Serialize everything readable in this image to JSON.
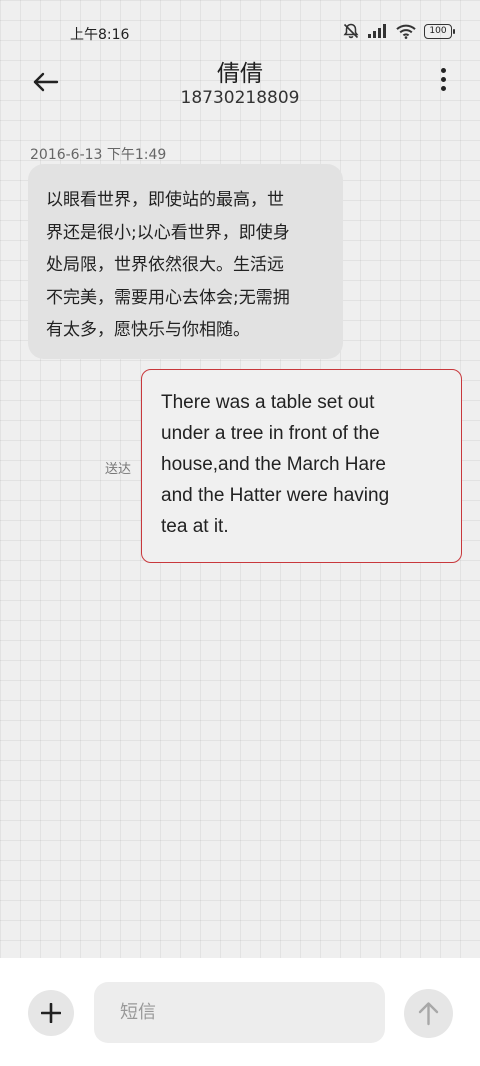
{
  "status_bar": {
    "time": "上午8:16",
    "battery": "100",
    "icons": [
      "bell-mute-icon",
      "signal-icon",
      "wifi-icon",
      "battery-icon"
    ]
  },
  "header": {
    "contact_name": "倩倩",
    "contact_number": "18730218809",
    "icons": [
      "back-arrow-icon",
      "more-vertical-icon"
    ]
  },
  "conversation": {
    "timestamp": "2016-6-13 下午1:49",
    "received": {
      "lines": [
        "以眼看世界，即使站的最高，世",
        "界还是很小;以心看世界，即使身",
        "处局限，世界依然很大。生活远",
        "不完美，需要用心去体会;无需拥",
        "有太多，愿快乐与你相随。"
      ]
    },
    "sent": {
      "status": "送达",
      "lines": [
        "There was a table set out",
        "under a tree in front of the",
        "house,and the March Hare",
        "and the Hatter were having",
        "tea at it."
      ]
    }
  },
  "compose": {
    "placeholder": "短信",
    "value": "",
    "icons": [
      "plus-icon",
      "send-arrow-up-icon"
    ]
  },
  "colors": {
    "background": "#efefef",
    "received_bubble": "#e2e2e2",
    "sent_bubble_border": "#c8383c",
    "compose_bar": "#ffffff"
  }
}
